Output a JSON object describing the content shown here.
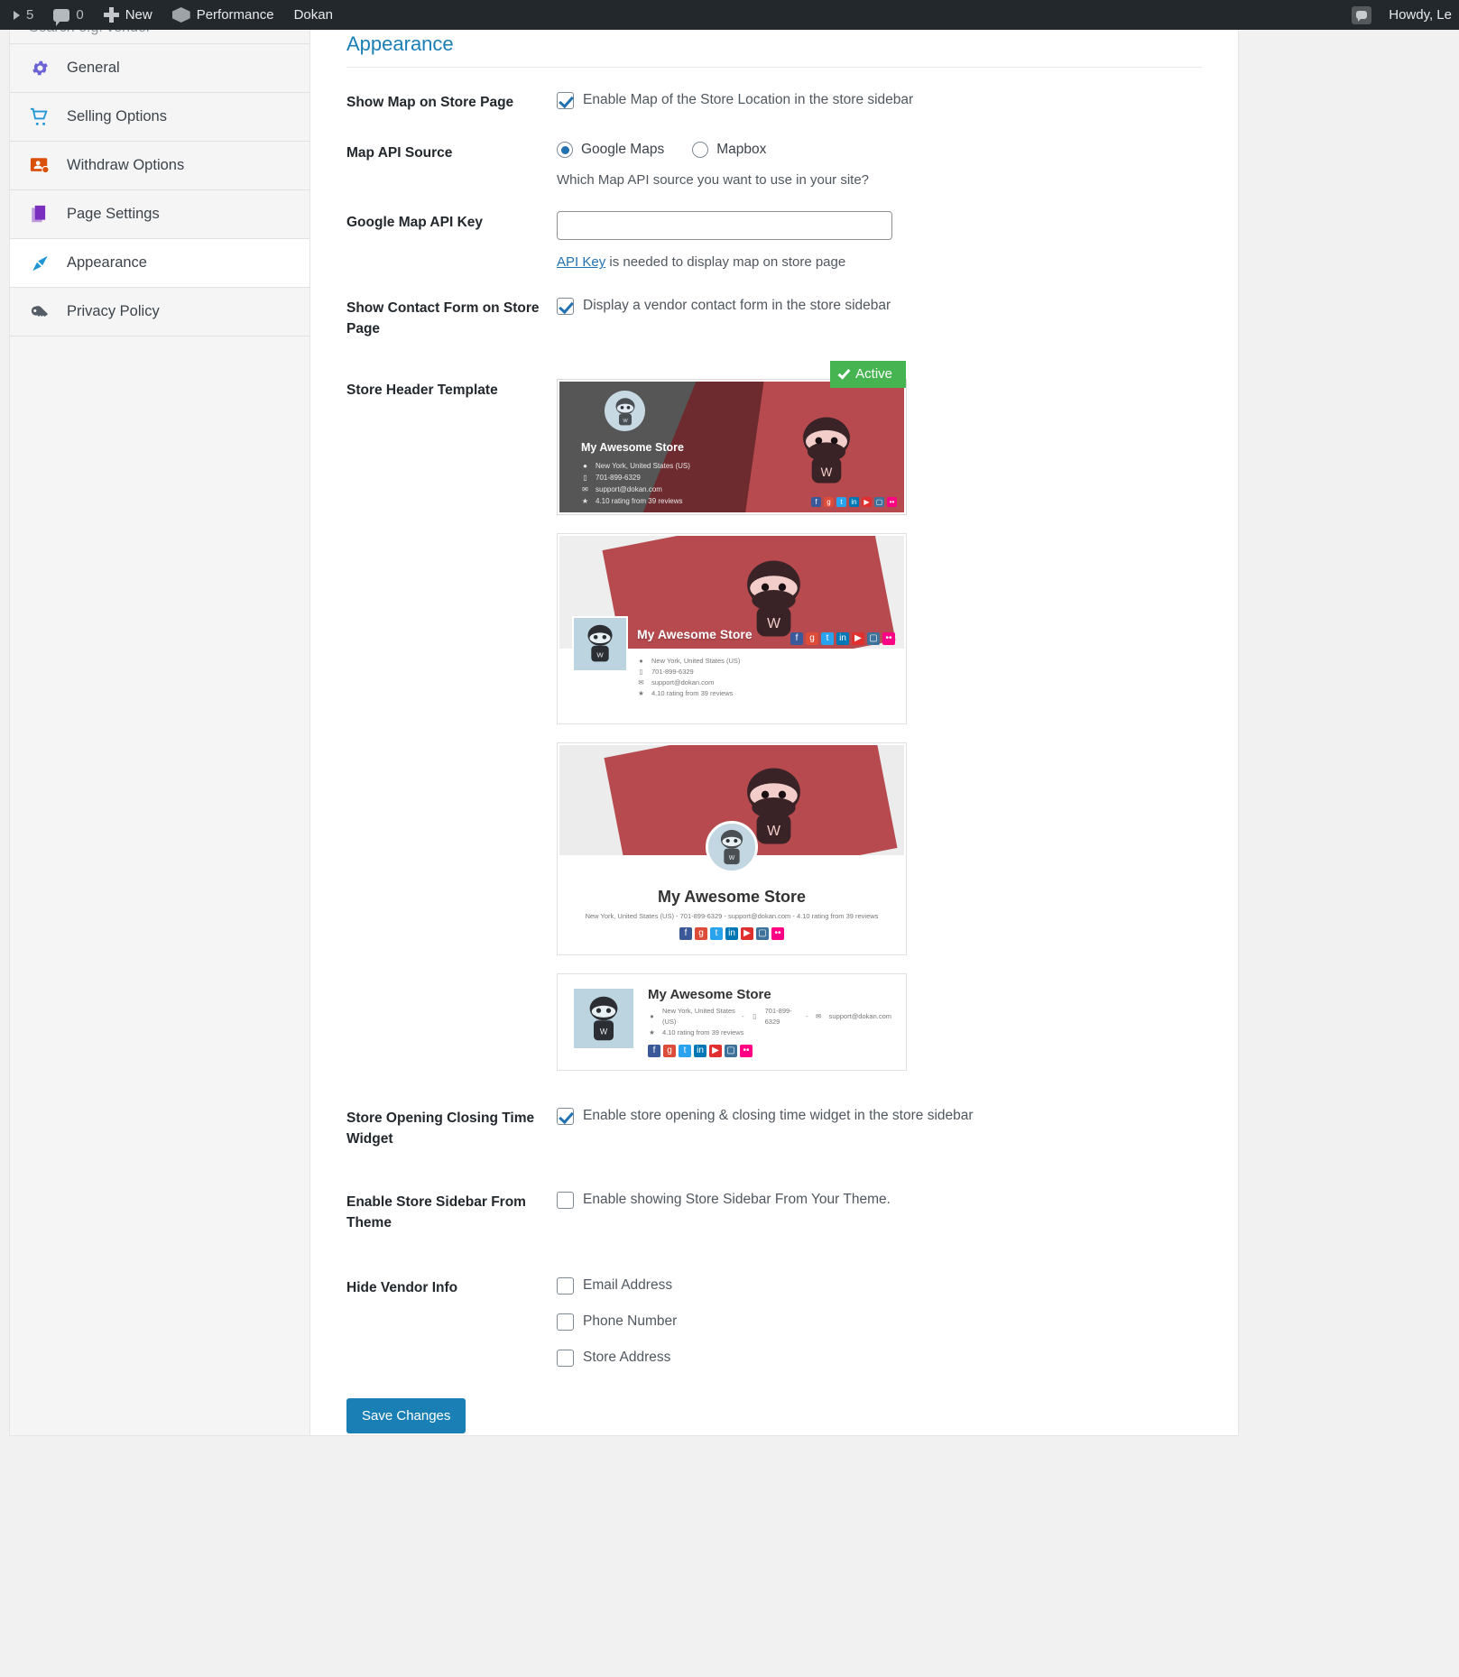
{
  "adminbar": {
    "updates_count": "5",
    "comments_count": "0",
    "new_label": "New",
    "performance_label": "Performance",
    "dokan_label": "Dokan",
    "howdy_label": "Howdy, Le"
  },
  "sidebar": {
    "search_placeholder": "Search e.g. vendor",
    "items": [
      {
        "label": "General",
        "icon": "gear-icon",
        "active": false
      },
      {
        "label": "Selling Options",
        "icon": "cart-icon",
        "active": false
      },
      {
        "label": "Withdraw Options",
        "icon": "withdraw-icon",
        "active": false
      },
      {
        "label": "Page Settings",
        "icon": "pages-icon",
        "active": false
      },
      {
        "label": "Appearance",
        "icon": "brush-icon",
        "active": true
      },
      {
        "label": "Privacy Policy",
        "icon": "key-icon",
        "active": false
      }
    ]
  },
  "page": {
    "title": "Appearance",
    "fields": {
      "show_map": {
        "label": "Show Map on Store Page",
        "checkbox_label": "Enable Map of the Store Location in the store sidebar",
        "checked": true
      },
      "map_api_source": {
        "label": "Map API Source",
        "options": [
          {
            "label": "Google Maps",
            "selected": true
          },
          {
            "label": "Mapbox",
            "selected": false
          }
        ],
        "helper": "Which Map API source you want to use in your site?"
      },
      "google_map_api_key": {
        "label": "Google Map API Key",
        "value": "",
        "placeholder": "",
        "helper_link": "API Key",
        "helper_rest": " is needed to display map on store page"
      },
      "show_contact_form": {
        "label": "Show Contact Form on Store Page",
        "checkbox_label": "Display a vendor contact form in the store sidebar",
        "checked": true
      },
      "store_header_template": {
        "label": "Store Header Template",
        "active_badge": "Active",
        "templates": [
          {
            "name": "layout-1",
            "active": true
          },
          {
            "name": "layout-2",
            "active": false
          },
          {
            "name": "layout-3",
            "active": false
          },
          {
            "name": "layout-4",
            "active": false
          }
        ]
      },
      "store_time_widget": {
        "label": "Store Opening Closing Time Widget",
        "checkbox_label": "Enable store opening & closing time widget in the store sidebar",
        "checked": true
      },
      "store_sidebar_theme": {
        "label": "Enable Store Sidebar From Theme",
        "checkbox_label": "Enable showing Store Sidebar From Your Theme.",
        "checked": false
      },
      "hide_vendor_info": {
        "label": "Hide Vendor Info",
        "options": [
          {
            "label": "Email Address",
            "checked": false
          },
          {
            "label": "Phone Number",
            "checked": false
          },
          {
            "label": "Store Address",
            "checked": false
          }
        ]
      }
    },
    "save_button": "Save Changes"
  },
  "store_preview": {
    "name": "My Awesome Store",
    "address": "New York, United States (US)",
    "phone": "701-899-6329",
    "email": "support@dokan.com",
    "rating": "4.10 rating from 39 reviews",
    "inline_meta": "New York, United States (US) - 701-899-6329 - support@dokan.com - 4.10 rating from 39 reviews",
    "social": [
      "f",
      "g+",
      "t",
      "in",
      "yt",
      "ig",
      "fl"
    ]
  },
  "colors": {
    "accent": "#1a7fb5",
    "active_badge": "#46b450",
    "adminbar": "#23282d",
    "brand_red": "#b74a4f"
  }
}
